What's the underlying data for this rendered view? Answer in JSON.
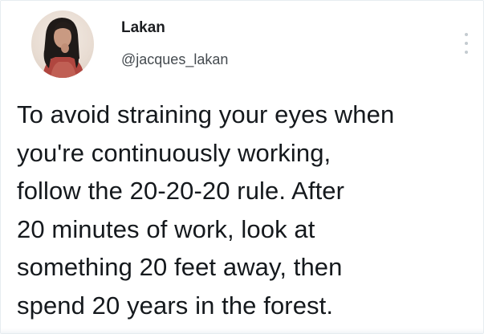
{
  "user": {
    "display_name": "Lakan",
    "handle": "@jacques_lakan"
  },
  "tweet": {
    "lines": [
      "To avoid straining your eyes when",
      "you're continuously working,",
      "follow the 20-20-20 rule. After",
      "20 minutes of work, look at",
      "something 20 feet away, then",
      "spend 20 years in the forest."
    ]
  },
  "icons": {
    "more": "more-vertical-icon",
    "avatar": "profile-photo"
  },
  "colors": {
    "text": "#15191d",
    "handle": "#444a4f",
    "border": "#e6ecf0",
    "icon": "#c4cbd0"
  }
}
